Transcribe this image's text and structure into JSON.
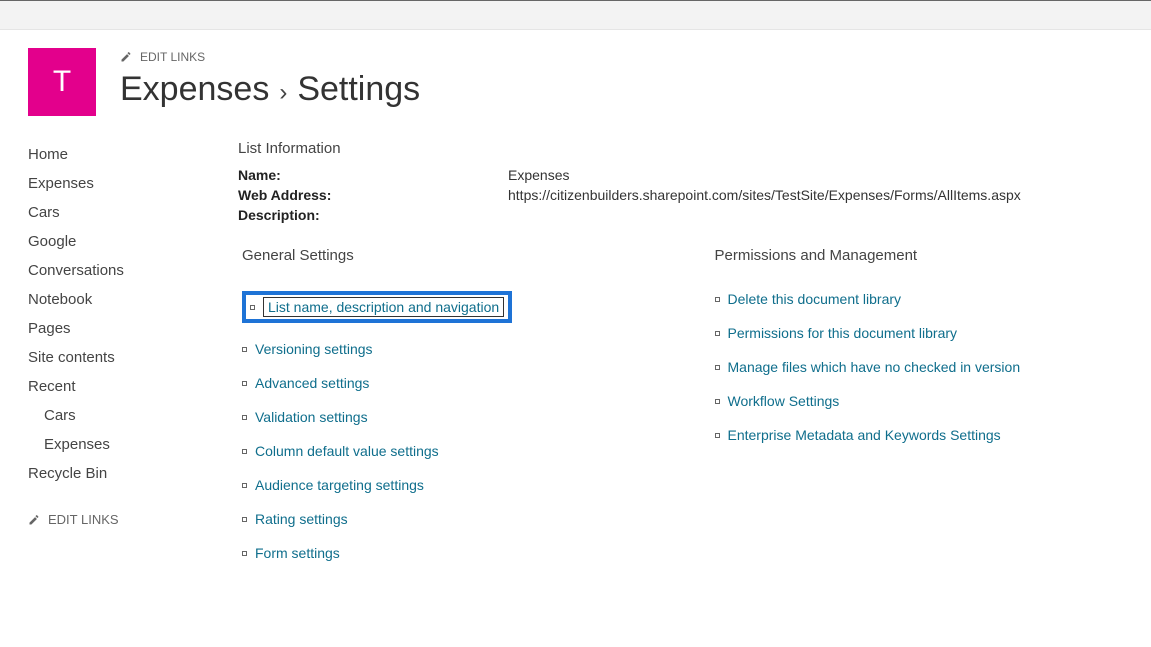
{
  "siteTile": "T",
  "editLinksLabel": "EDIT LINKS",
  "breadcrumb": {
    "part1": "Expenses",
    "part2": "Settings"
  },
  "nav": {
    "items": [
      {
        "label": "Home"
      },
      {
        "label": "Expenses"
      },
      {
        "label": "Cars"
      },
      {
        "label": "Google"
      },
      {
        "label": "Conversations"
      },
      {
        "label": "Notebook"
      },
      {
        "label": "Pages"
      },
      {
        "label": "Site contents"
      },
      {
        "label": "Recent"
      },
      {
        "label": "Cars"
      },
      {
        "label": "Expenses"
      },
      {
        "label": "Recycle Bin"
      }
    ]
  },
  "listInfo": {
    "heading": "List Information",
    "nameLabel": "Name:",
    "nameValue": "Expenses",
    "webLabel": "Web Address:",
    "webValue": "https://citizenbuilders.sharepoint.com/sites/TestSite/Expenses/Forms/AllItems.aspx",
    "descLabel": "Description:",
    "descValue": ""
  },
  "general": {
    "heading": "General Settings",
    "links": [
      "List name, description and navigation",
      "Versioning settings",
      "Advanced settings",
      "Validation settings",
      "Column default value settings",
      "Audience targeting settings",
      "Rating settings",
      "Form settings"
    ]
  },
  "perms": {
    "heading": "Permissions and Management",
    "links": [
      "Delete this document library",
      "Permissions for this document library",
      "Manage files which have no checked in version",
      "Workflow Settings",
      "Enterprise Metadata and Keywords Settings"
    ]
  }
}
